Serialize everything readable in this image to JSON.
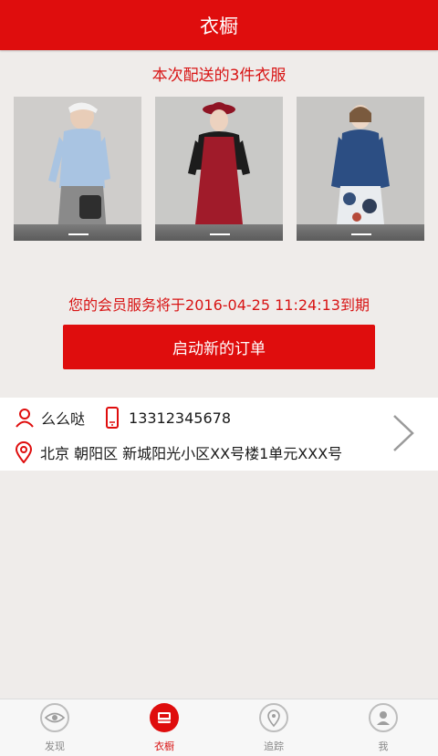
{
  "header": {
    "title": "衣橱"
  },
  "delivery": {
    "title": "本次配送的3件衣服",
    "items": [
      {
        "name": "light blue shirt with grey pocket skirt"
      },
      {
        "name": "red dress with red hat"
      },
      {
        "name": "denim shirt with printed skirt"
      }
    ]
  },
  "membership": {
    "notice": "您的会员服务将于2016-04-25 11:24:13到期",
    "button_label": "启动新的订单"
  },
  "contact": {
    "name": "么么哒",
    "phone": "13312345678",
    "address": "北京 朝阳区 新城阳光小区XX号楼1单元XXX号"
  },
  "tabs": [
    {
      "label": "发现",
      "icon": "eye-icon",
      "active": false
    },
    {
      "label": "衣橱",
      "icon": "wardrobe-icon",
      "active": true
    },
    {
      "label": "追踪",
      "icon": "location-pin-icon",
      "active": false
    },
    {
      "label": "我",
      "icon": "user-icon",
      "active": false
    }
  ],
  "colors": {
    "brand_red": "#df0d0d",
    "text_red": "#d81414",
    "background": "#efecea"
  }
}
